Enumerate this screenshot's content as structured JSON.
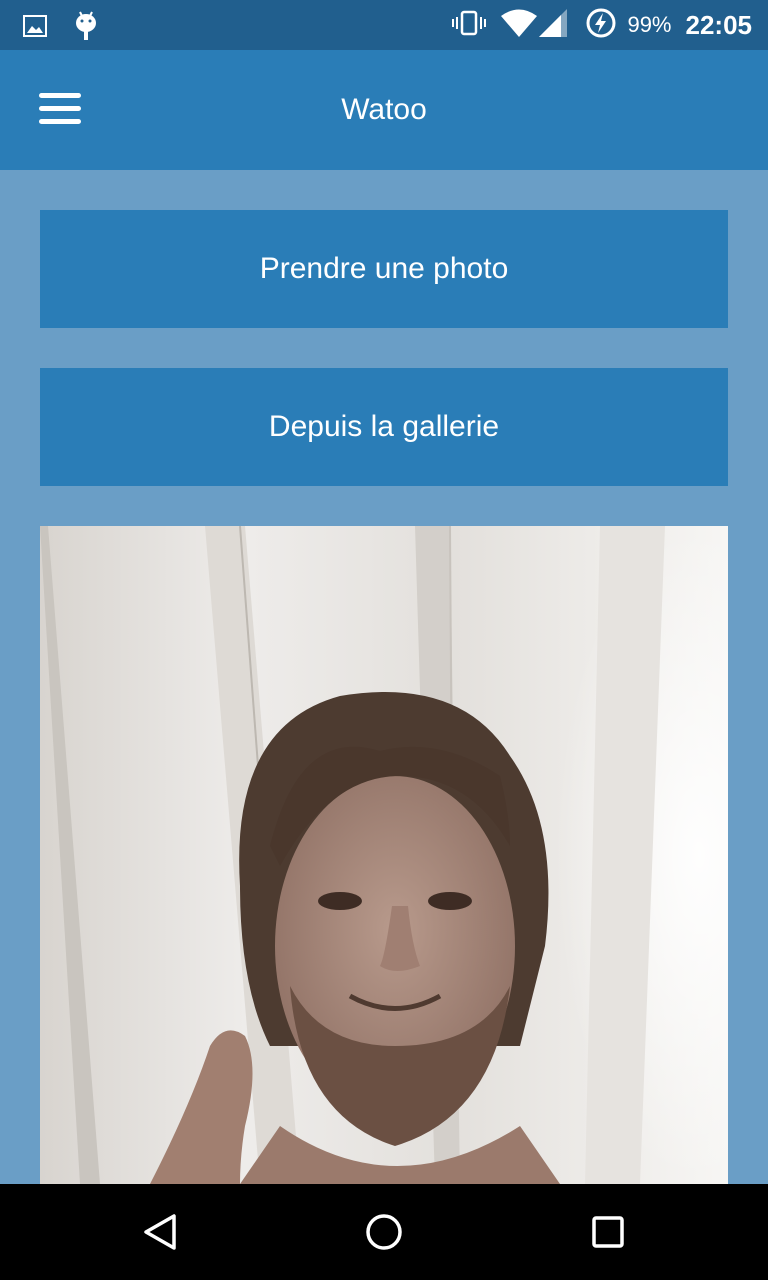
{
  "status_bar": {
    "battery_percent": "99%",
    "time": "22:05",
    "icons": [
      "image-notification-icon",
      "android-debug-icon",
      "vibrate-icon",
      "wifi-icon",
      "cell-signal-icon",
      "battery-charging-icon"
    ]
  },
  "app_bar": {
    "title": "Watoo",
    "menu_icon": "hamburger-menu-icon"
  },
  "actions": {
    "take_photo_label": "Prendre une photo",
    "gallery_label": "Depuis la gallerie"
  },
  "photo": {
    "description_icon": "selected-photo"
  },
  "nav_bar": {
    "icons": [
      "back-icon",
      "home-icon",
      "recents-icon"
    ]
  },
  "colors": {
    "status_bar": "#215f8e",
    "app_bar": "#2a7db7",
    "background": "#6a9ec6",
    "button": "#2a7db7",
    "nav_bar": "#000000"
  }
}
